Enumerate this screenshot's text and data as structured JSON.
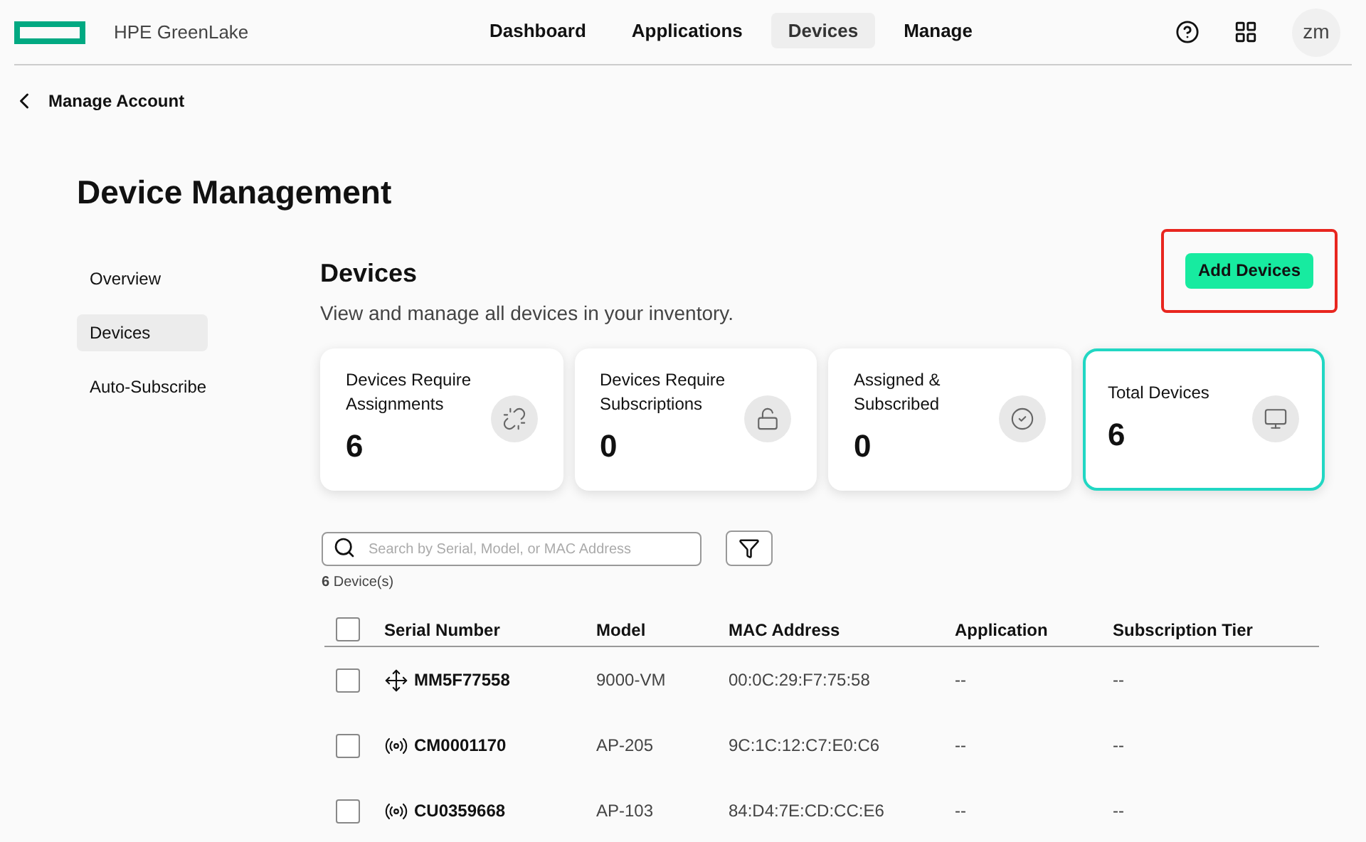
{
  "header": {
    "brand": "HPE GreenLake",
    "nav": [
      {
        "label": "Dashboard",
        "selected": false
      },
      {
        "label": "Applications",
        "selected": false
      },
      {
        "label": "Devices",
        "selected": true
      },
      {
        "label": "Manage",
        "selected": false
      }
    ],
    "avatar": "zm"
  },
  "back_link": "Manage Account",
  "page_title": "Device Management",
  "sidebar": {
    "items": [
      {
        "label": "Overview",
        "selected": false
      },
      {
        "label": "Devices",
        "selected": true
      },
      {
        "label": "Auto-Subscribe",
        "selected": false
      }
    ]
  },
  "section": {
    "title": "Devices",
    "subtitle": "View and manage all devices in your inventory.",
    "add_button": {
      "label": "Add Devices",
      "highlighted": true
    }
  },
  "cards": [
    {
      "label": "Devices Require Assignments",
      "value": "6",
      "kind": "unlinked",
      "selected": false
    },
    {
      "label": "Devices Require Subscriptions",
      "value": "0",
      "kind": "unlocked",
      "selected": false
    },
    {
      "label": "Assigned & Subscribed",
      "value": "0",
      "kind": "check",
      "selected": false
    },
    {
      "label": "Total Devices",
      "value": "6",
      "kind": "monitor",
      "selected": true
    }
  ],
  "search": {
    "placeholder": "Search by Serial, Model, or MAC Address"
  },
  "count": {
    "number": "6",
    "unit": "Device(s)"
  },
  "table": {
    "select_all_checked": false,
    "columns": [
      "Serial Number",
      "Model",
      "MAC Address",
      "Application",
      "Subscription Tier"
    ],
    "rows": [
      {
        "kind": "gateway",
        "checked": false,
        "cells": [
          "MM5F77558",
          "9000-VM",
          "00:0C:29:F7:75:58",
          "--",
          "--"
        ]
      },
      {
        "kind": "access_point",
        "checked": false,
        "cells": [
          "CM0001170",
          "AP-205",
          "9C:1C:12:C7:E0:C6",
          "--",
          "--"
        ]
      },
      {
        "kind": "access_point",
        "checked": false,
        "cells": [
          "CU0359668",
          "AP-103",
          "84:D4:7E:CD:CC:E6",
          "--",
          "--"
        ]
      }
    ]
  }
}
